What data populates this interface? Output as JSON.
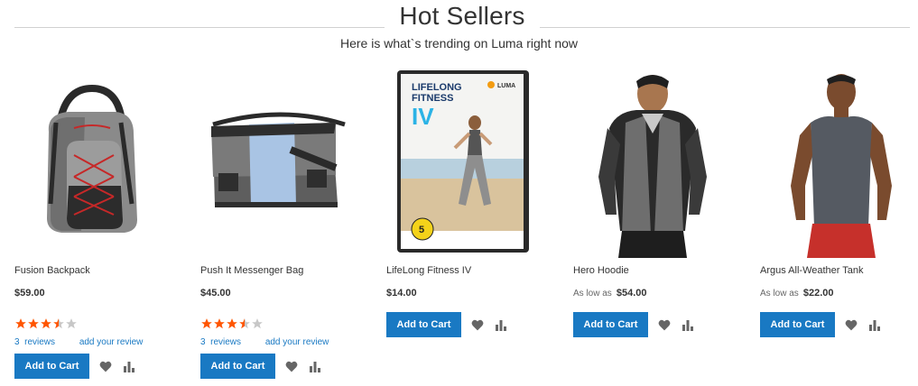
{
  "header": {
    "title": "Hot Sellers",
    "subtitle": "Here is what`s trending on Luma right now"
  },
  "colors": {
    "accent": "#1979c3",
    "star_filled": "#ff5501",
    "star_empty": "#c7c7c7",
    "icon": "#666666"
  },
  "products": [
    {
      "name": "Fusion Backpack",
      "price_label": "",
      "price": "$59.00",
      "rating_percent": 67,
      "reviews_count": "3",
      "reviews_label": "reviews",
      "add_review_label": "add your review",
      "add_to_cart_label": "Add to Cart",
      "wishlist_icon": "heart-icon",
      "compare_icon": "compare-icon"
    },
    {
      "name": "Push It Messenger Bag",
      "price_label": "",
      "price": "$45.00",
      "rating_percent": 67,
      "reviews_count": "3",
      "reviews_label": "reviews",
      "add_review_label": "add your review",
      "add_to_cart_label": "Add to Cart",
      "wishlist_icon": "heart-icon",
      "compare_icon": "compare-icon"
    },
    {
      "name": "LifeLong Fitness IV",
      "price_label": "",
      "price": "$14.00",
      "add_to_cart_label": "Add to Cart",
      "wishlist_icon": "heart-icon",
      "compare_icon": "compare-icon",
      "dvd": {
        "title_line1": "LIFELONG",
        "title_line2": "FITNESS",
        "title_line3": "IV",
        "brand": "LUMA",
        "badge": "5"
      }
    },
    {
      "name": "Hero Hoodie",
      "price_label": "As low as",
      "price": "$54.00",
      "add_to_cart_label": "Add to Cart",
      "wishlist_icon": "heart-icon",
      "compare_icon": "compare-icon"
    },
    {
      "name": "Argus All-Weather Tank",
      "price_label": "As low as",
      "price": "$22.00",
      "add_to_cart_label": "Add to Cart",
      "wishlist_icon": "heart-icon",
      "compare_icon": "compare-icon"
    }
  ]
}
